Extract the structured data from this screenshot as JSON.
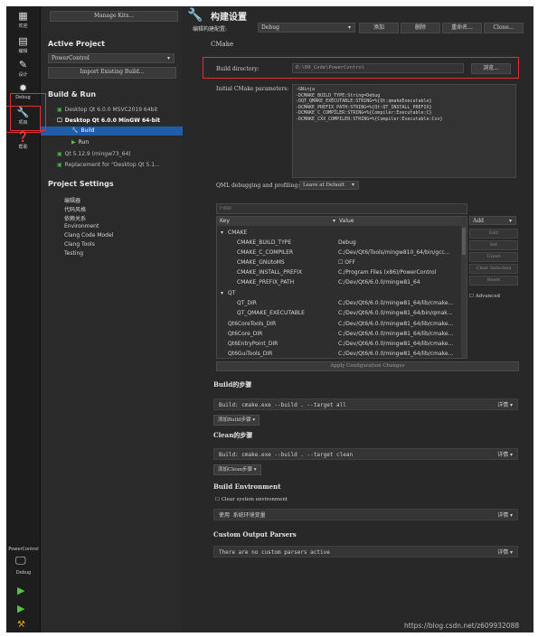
{
  "modebar": {
    "items": [
      {
        "label": "欢迎",
        "icon": "grid-icon"
      },
      {
        "label": "编辑",
        "icon": "doc-icon"
      },
      {
        "label": "设计",
        "icon": "pen-icon"
      },
      {
        "label": "Debug",
        "icon": "bug-icon"
      },
      {
        "label": "项目",
        "icon": "wrench-icon"
      },
      {
        "label": "帮助",
        "icon": "help-icon"
      }
    ],
    "bottom_project": "PowerControl",
    "bottom_config": "Debug"
  },
  "left": {
    "manage_kits": "Manage Kits...",
    "active_project_header": "Active Project",
    "project_name": "PowerControl",
    "import_build": "Import Existing Build...",
    "build_run_header": "Build & Run",
    "kits": [
      {
        "label": "Desktop Qt 6.0.0 MSVC2019 64bit"
      },
      {
        "label": "Desktop Qt 6.0.0 MinGW 64-bit"
      },
      {
        "label": "Build"
      },
      {
        "label": "Run"
      },
      {
        "label": "Qt 5.12.9 (mingw73_64)"
      },
      {
        "label": "Replacement for \"Desktop Qt 5.1..."
      }
    ],
    "project_settings_header": "Project Settings",
    "settings": [
      "编辑器",
      "代码风格",
      "依赖关系",
      "Environment",
      "Clang Code Model",
      "Clang Tools",
      "Testing"
    ]
  },
  "right": {
    "title": "构建设置",
    "edit_config_label": "编辑构建配置:",
    "config_value": "Debug",
    "add": "添加",
    "delete": "删除",
    "rename": "重命名...",
    "clone": "Clone...",
    "cmake_section": "CMake",
    "build_dir_label": "Build directory:",
    "build_dir_value": "D:\\00_Code\\PowerControl",
    "browse": "浏览...",
    "initial_params_label": "Initial CMake parameters:",
    "initial_params": [
      "-GNinja",
      "-DCMAKE_BUILD_TYPE:String=Debug",
      "-DQT_QMAKE_EXECUTABLE:STRING=%{Qt:qmakeExecutable}",
      "-DCMAKE_PREFIX_PATH:STRING=%{Qt:QT_INSTALL_PREFIX}",
      "-DCMAKE_C_COMPILER:STRING=%{Compiler:Executable:C}",
      "-DCMAKE_CXX_COMPILER:STRING=%{Compiler:Executable:Cxx}"
    ],
    "qml_debug_label": "QML debugging and profiling:",
    "qml_debug_value": "Leave at Default",
    "filter_placeholder": "Filter",
    "table_key": "Key",
    "table_value": "Value",
    "rows": [
      {
        "key": "CMAKE",
        "value": "",
        "indent": 0,
        "group": true
      },
      {
        "key": "CMAKE_BUILD_TYPE",
        "value": "Debug",
        "indent": 2
      },
      {
        "key": "CMAKE_C_COMPILER",
        "value": "C:/Dev/Qt6/Tools/mingw810_64/bin/gcc...",
        "indent": 2
      },
      {
        "key": "CMAKE_GNUtoMS",
        "value": "OFF",
        "indent": 2,
        "checkbox": true
      },
      {
        "key": "CMAKE_INSTALL_PREFIX",
        "value": "C:/Program Files (x86)/PowerControl",
        "indent": 2
      },
      {
        "key": "CMAKE_PREFIX_PATH",
        "value": "C:/Dev/Qt6/6.0.0/mingw81_64",
        "indent": 2
      },
      {
        "key": "QT",
        "value": "",
        "indent": 0,
        "group": true
      },
      {
        "key": "QT_DIR",
        "value": "C:/Dev/Qt6/6.0.0/mingw81_64/lib/cmake...",
        "indent": 2
      },
      {
        "key": "QT_QMAKE_EXECUTABLE",
        "value": "C:/Dev/Qt6/6.0.0/mingw81_64/bin/qmak...",
        "indent": 2
      },
      {
        "key": "Qt6CoreTools_DIR",
        "value": "C:/Dev/Qt6/6.0.0/mingw81_64/lib/cmake...",
        "indent": 1
      },
      {
        "key": "Qt6Core_DIR",
        "value": "C:/Dev/Qt6/6.0.0/mingw81_64/lib/cmake...",
        "indent": 1
      },
      {
        "key": "Qt6EntryPoint_DIR",
        "value": "C:/Dev/Qt6/6.0.0/mingw81_64/lib/cmake...",
        "indent": 1
      },
      {
        "key": "Qt6GuiTools_DIR",
        "value": "C:/Dev/Qt6/6.0.0/mingw81_64/lib/cmake...",
        "indent": 1
      }
    ],
    "side_buttons": [
      "Edit",
      "Set",
      "Unset",
      "Clear Selection",
      "Reset"
    ],
    "add_menu": "Add",
    "advanced": "Advanced",
    "apply": "Apply Configuration Changes",
    "build_steps_header": "Build的步骤",
    "build_step": "Build: cmake.exe --build . --target all",
    "details": "详情",
    "add_build_step": "添加Build步骤",
    "clean_steps_header": "Clean的步骤",
    "clean_step": "Build: cmake.exe --build . --target clean",
    "add_clean_step": "添加Clean步骤",
    "build_env_header": "Build Environment",
    "clear_env": "Clear system environment",
    "use_env": "使用 系统环境变量",
    "custom_parsers_header": "Custom Output Parsers",
    "no_parsers": "There are no custom parsers active"
  },
  "watermark": "https://blog.csdn.net/z609932088"
}
